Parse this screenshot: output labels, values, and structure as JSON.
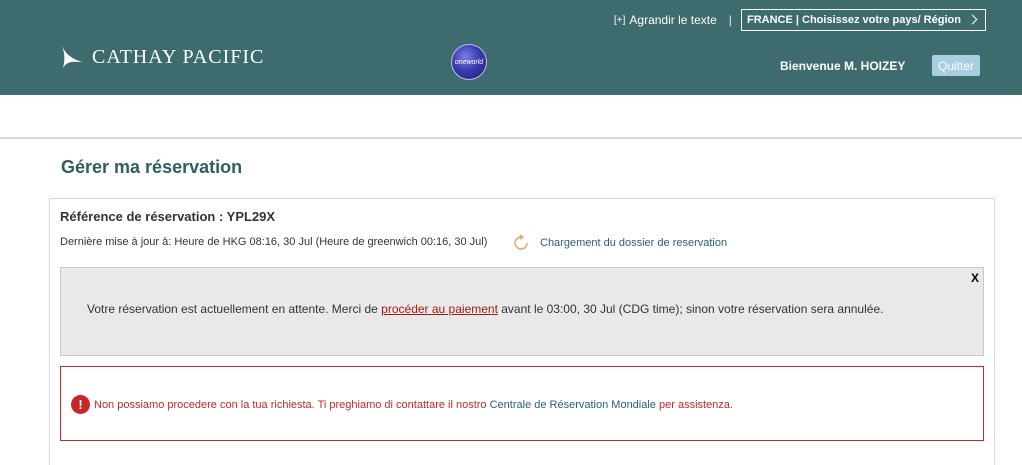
{
  "header": {
    "enlarge_bracket": "[+]",
    "enlarge_label": "Agrandir le texte",
    "enlarge_sep": "|",
    "country_selector": "FRANCE | Choisissez votre pays/ Région",
    "brand_name": "CATHAY PACIFIC",
    "oneworld_label": "oneworld",
    "welcome": "Bienvenue M. HOIZEY",
    "logout_label": "Quitter"
  },
  "main": {
    "page_title": "Gérer ma réservation",
    "booking_reference": "Référence de réservation : YPL29X",
    "last_updated": "Dernière mise à jour à: Heure de HKG 08:16, 30 Jul (Heure de greenwich 00:16, 30 Jul)",
    "reload_label": "Chargement du dossier de reservation",
    "notice": {
      "close_label": "X",
      "text_before": "Votre réservation est actuellement en attente. Merci de ",
      "link": "procéder au paiement",
      "text_after": " avant le 03:00, 30 Jul (CDG time); sinon votre réservation sera annulée."
    },
    "error": {
      "icon": "!",
      "text_before": "Non possiamo procedere con la tua richiesta. Ti preghiamo di contattare il nostro ",
      "link": "Centrale de Réservation Mondiale",
      "text_after": " per assistenza."
    }
  },
  "colors": {
    "header_bg": "#3e6c6e",
    "error_red": "#c02a2a",
    "link_teal": "#2c5e7c"
  }
}
